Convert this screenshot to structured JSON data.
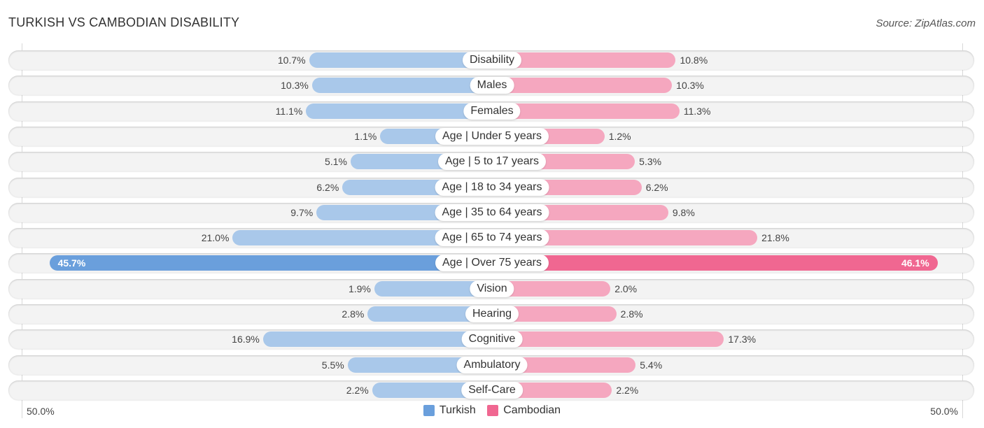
{
  "header": {
    "title": "TURKISH VS CAMBODIAN DISABILITY",
    "source": "Source: ZipAtlas.com"
  },
  "colors": {
    "turkish_strong": "#6a9fdc",
    "turkish_light": "#a9c8ea",
    "cambodian_strong": "#f06791",
    "cambodian_light": "#f5a7bf"
  },
  "chart_data": {
    "type": "bar",
    "orientation": "diverging-horizontal",
    "title": "TURKISH VS CAMBODIAN DISABILITY",
    "categories": [
      "Disability",
      "Males",
      "Females",
      "Age | Under 5 years",
      "Age | 5 to 17 years",
      "Age | 18 to 34 years",
      "Age | 35 to 64 years",
      "Age | 65 to 74 years",
      "Age | Over 75 years",
      "Vision",
      "Hearing",
      "Cognitive",
      "Ambulatory",
      "Self-Care"
    ],
    "series": [
      {
        "name": "Turkish",
        "side": "left",
        "values": [
          10.7,
          10.3,
          11.1,
          1.1,
          5.1,
          6.2,
          9.7,
          21.0,
          45.7,
          1.9,
          2.8,
          16.9,
          5.5,
          2.2
        ]
      },
      {
        "name": "Cambodian",
        "side": "right",
        "values": [
          10.8,
          10.3,
          11.3,
          1.2,
          5.3,
          6.2,
          9.8,
          21.8,
          46.1,
          2.0,
          2.8,
          17.3,
          5.4,
          2.2
        ]
      }
    ],
    "value_labels": {
      "Turkish": [
        "10.7%",
        "10.3%",
        "11.1%",
        "1.1%",
        "5.1%",
        "6.2%",
        "9.7%",
        "21.0%",
        "45.7%",
        "1.9%",
        "2.8%",
        "16.9%",
        "5.5%",
        "2.2%"
      ],
      "Cambodian": [
        "10.8%",
        "10.3%",
        "11.3%",
        "1.2%",
        "5.3%",
        "6.2%",
        "9.8%",
        "21.8%",
        "46.1%",
        "2.0%",
        "2.8%",
        "17.3%",
        "5.4%",
        "2.2%"
      ]
    },
    "xlim": [
      -50,
      50
    ],
    "axis_labels": {
      "left": "50.0%",
      "right": "50.0%"
    },
    "legend": {
      "position": "bottom-center",
      "entries": [
        "Turkish",
        "Cambodian"
      ]
    },
    "grid": false
  }
}
